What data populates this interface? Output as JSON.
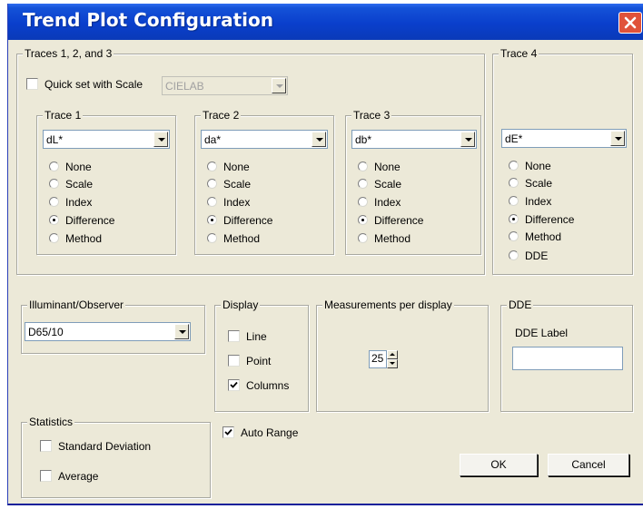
{
  "window": {
    "title": "Trend Plot Configuration"
  },
  "traces_group": {
    "label": "Traces 1, 2, and 3",
    "quick_set_label": "Quick set with Scale",
    "quick_set_checked": false,
    "scale_select_value": "CIELAB",
    "traces": [
      {
        "label": "Trace 1",
        "select_value": "dL*",
        "options": [
          "None",
          "Scale",
          "Index",
          "Difference",
          "Method"
        ],
        "selected": "Difference"
      },
      {
        "label": "Trace 2",
        "select_value": "da*",
        "options": [
          "None",
          "Scale",
          "Index",
          "Difference",
          "Method"
        ],
        "selected": "Difference"
      },
      {
        "label": "Trace 3",
        "select_value": "db*",
        "options": [
          "None",
          "Scale",
          "Index",
          "Difference",
          "Method"
        ],
        "selected": "Difference"
      }
    ]
  },
  "trace4": {
    "label": "Trace 4",
    "select_value": "dE*",
    "options": [
      "None",
      "Scale",
      "Index",
      "Difference",
      "Method",
      "DDE"
    ],
    "selected": "Difference"
  },
  "illuminant": {
    "label": "Illuminant/Observer",
    "value": "D65/10"
  },
  "display": {
    "label": "Display",
    "options": [
      {
        "label": "Line",
        "checked": false
      },
      {
        "label": "Point",
        "checked": false
      },
      {
        "label": "Columns",
        "checked": true
      }
    ]
  },
  "measurements": {
    "label": "Measurements per display",
    "value": "25"
  },
  "dde": {
    "label": "DDE",
    "field_label": "DDE Label",
    "value": ""
  },
  "statistics": {
    "label": "Statistics",
    "options": [
      {
        "label": "Standard Deviation",
        "checked": false
      },
      {
        "label": "Average",
        "checked": false
      }
    ]
  },
  "auto_range": {
    "label": "Auto Range",
    "checked": true
  },
  "buttons": {
    "ok": "OK",
    "cancel": "Cancel"
  },
  "colors": {
    "titlebar": "#0a3fcc",
    "dialog_bg": "#ece9d8",
    "close_button": "#e0523a"
  },
  "icons": {
    "close": "close-icon",
    "checkmark": "checkmark-icon"
  }
}
